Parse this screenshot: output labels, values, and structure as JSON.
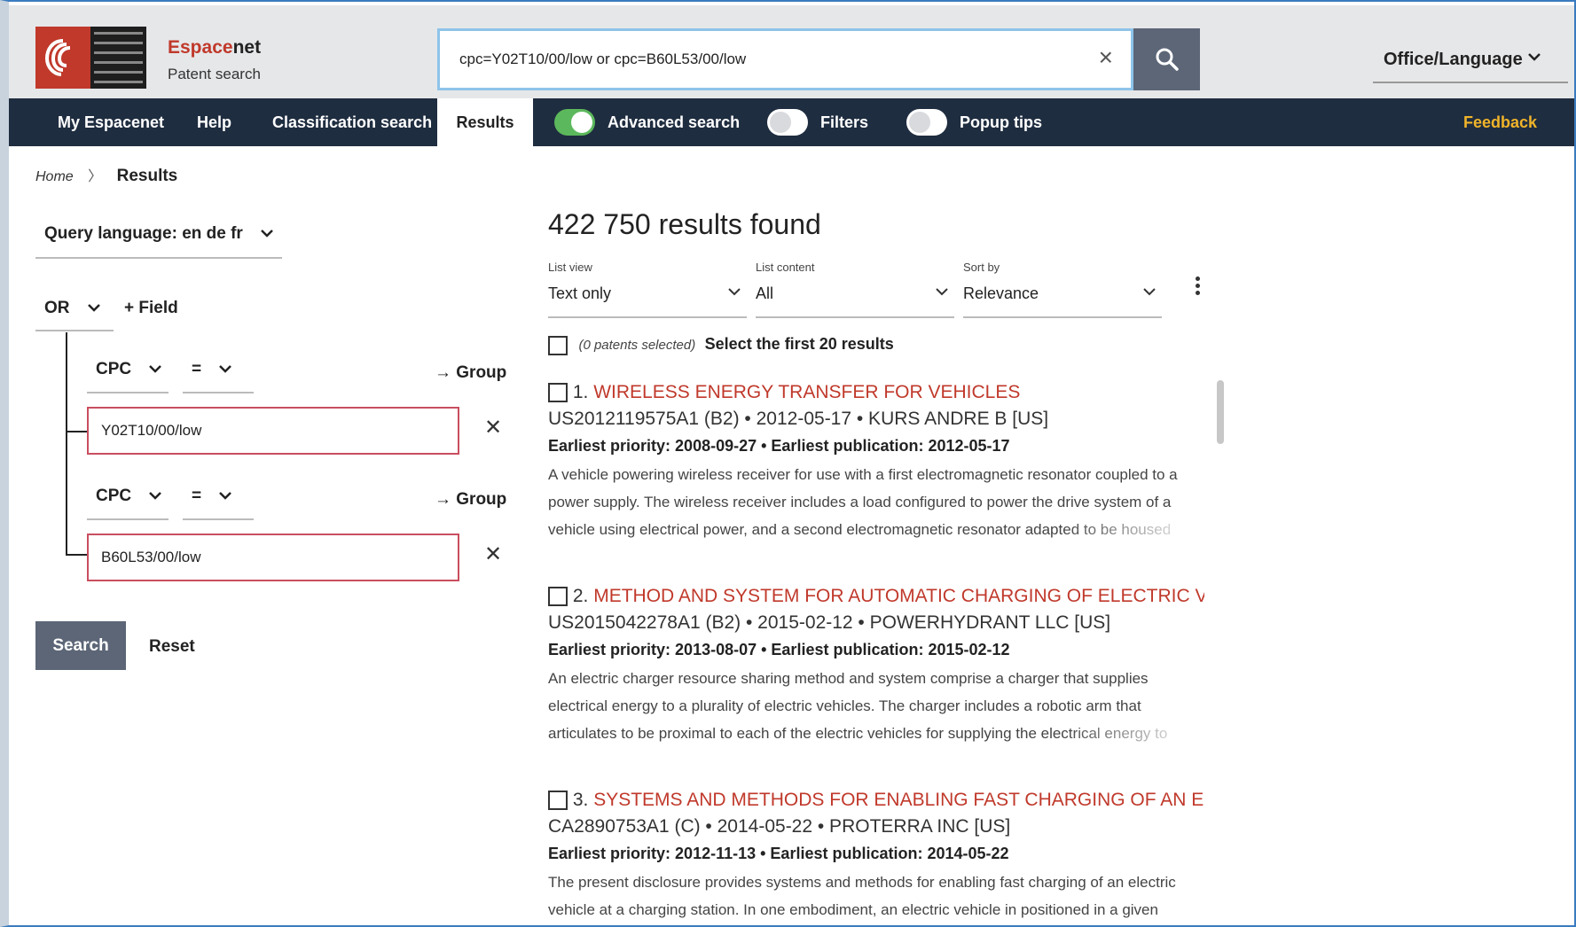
{
  "header": {
    "brand_name_a": "Espace",
    "brand_name_b": "net",
    "brand_sub": "Patent search",
    "search_query": "cpc=Y02T10/00/low or cpc=B60L53/00/low",
    "office_language": "Office/Language"
  },
  "nav": {
    "my_espacenet": "My Espacenet",
    "help": "Help",
    "classification_search": "Classification search",
    "results": "Results",
    "advanced_search": "Advanced search",
    "filters": "Filters",
    "popup_tips": "Popup tips",
    "feedback": "Feedback"
  },
  "breadcrumb": {
    "home": "Home",
    "current": "Results"
  },
  "left": {
    "query_language": "Query language: en de fr",
    "operator": "OR",
    "add_field": "+ Field",
    "fields": [
      {
        "field": "CPC",
        "op": "=",
        "group": "→ Group",
        "value": "Y02T10/00/low"
      },
      {
        "field": "CPC",
        "op": "=",
        "group": "→ Group",
        "value": "B60L53/00/low"
      }
    ],
    "search_btn": "Search",
    "reset_btn": "Reset"
  },
  "results": {
    "count": "422 750 results found",
    "list_view_label": "List view",
    "list_view_value": "Text only",
    "list_content_label": "List content",
    "list_content_value": "All",
    "sort_label": "Sort by",
    "sort_value": "Relevance",
    "selected_text": "(0 patents selected)",
    "select_first": "Select the first 20 results",
    "items": [
      {
        "num": "1.",
        "title": "WIRELESS ENERGY TRANSFER FOR VEHICLES",
        "meta": "US2012119575A1 (B2) • 2012-05-17 • KURS ANDRE B [US]",
        "dates": "Earliest priority: 2008-09-27 • Earliest publication: 2012-05-17",
        "abstract": "A vehicle powering wireless receiver for use with a first electromagnetic resonator coupled to a power supply. The wireless receiver includes a load configured to power the drive system of a vehicle using electrical power, and a second electromagnetic resonator adapted to be housed"
      },
      {
        "num": "2.",
        "title": "METHOD AND SYSTEM FOR AUTOMATIC CHARGING OF ELECTRIC VE...",
        "meta": "US2015042278A1 (B2) • 2015-02-12 • POWERHYDRANT LLC [US]",
        "dates": "Earliest priority: 2013-08-07 • Earliest publication: 2015-02-12",
        "abstract": "An electric charger resource sharing method and system comprise a charger that supplies electrical energy to a plurality of electric vehicles. The charger includes a robotic arm that articulates to be proximal to each of the electric vehicles for supplying the electrical energy to"
      },
      {
        "num": "3.",
        "title": "SYSTEMS AND METHODS FOR ENABLING FAST CHARGING OF AN EL...",
        "meta": "CA2890753A1 (C) • 2014-05-22 • PROTERRA INC [US]",
        "dates": "Earliest priority: 2012-11-13 • Earliest publication: 2014-05-22",
        "abstract": "The present disclosure provides systems and methods for enabling fast charging of an electric vehicle at a charging station. In one embodiment, an electric vehicle in positioned in a given"
      }
    ]
  }
}
